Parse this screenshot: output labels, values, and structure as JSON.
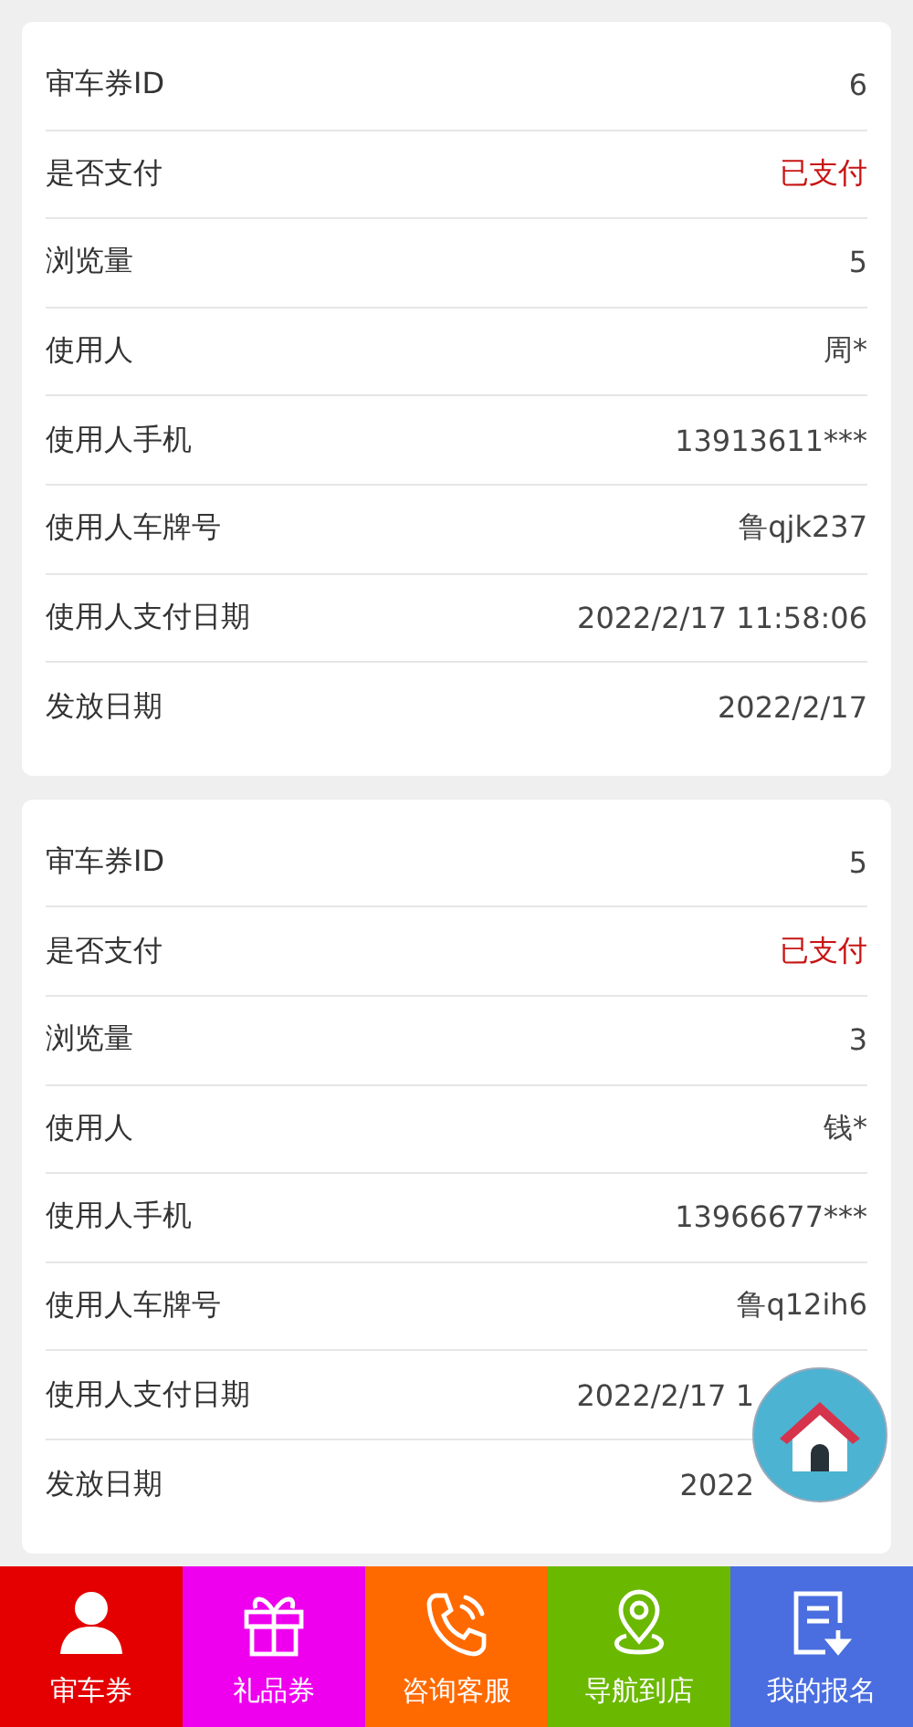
{
  "cards": [
    {
      "rows": [
        {
          "label": "审车券ID",
          "value": "6",
          "kind": "plain"
        },
        {
          "label": "是否支付",
          "value": "已支付",
          "kind": "alert"
        },
        {
          "label": "浏览量",
          "value": "5",
          "kind": "plain"
        },
        {
          "label": "使用人",
          "value": "周*",
          "kind": "plain"
        },
        {
          "label": "使用人手机",
          "value": "13913611***",
          "kind": "plain"
        },
        {
          "label": "使用人车牌号",
          "value": "鲁qjk237",
          "kind": "plain"
        },
        {
          "label": "使用人支付日期",
          "value": "2022/2/17 11:58:06",
          "kind": "plain"
        },
        {
          "label": "发放日期",
          "value": "2022/2/17",
          "kind": "plain"
        }
      ]
    },
    {
      "rows": [
        {
          "label": "审车券ID",
          "value": "5",
          "kind": "plain"
        },
        {
          "label": "是否支付",
          "value": "已支付",
          "kind": "alert"
        },
        {
          "label": "浏览量",
          "value": "3",
          "kind": "plain"
        },
        {
          "label": "使用人",
          "value": "钱*",
          "kind": "plain"
        },
        {
          "label": "使用人手机",
          "value": "13966677***",
          "kind": "plain"
        },
        {
          "label": "使用人车牌号",
          "value": "鲁q12ih6",
          "kind": "plain"
        },
        {
          "label": "使用人支付日期",
          "value": "2022/2/17 1",
          "kind": "covered"
        },
        {
          "label": "发放日期",
          "value": "2022",
          "kind": "covered"
        }
      ]
    }
  ],
  "tabs": [
    {
      "label": "审车券",
      "color": "#e40000"
    },
    {
      "label": "礼品券",
      "color": "#ee00ee"
    },
    {
      "label": "咨询客服",
      "color": "#ff6a00"
    },
    {
      "label": "导航到店",
      "color": "#6ab800"
    },
    {
      "label": "我的报名",
      "color": "#4a6ee0"
    }
  ]
}
